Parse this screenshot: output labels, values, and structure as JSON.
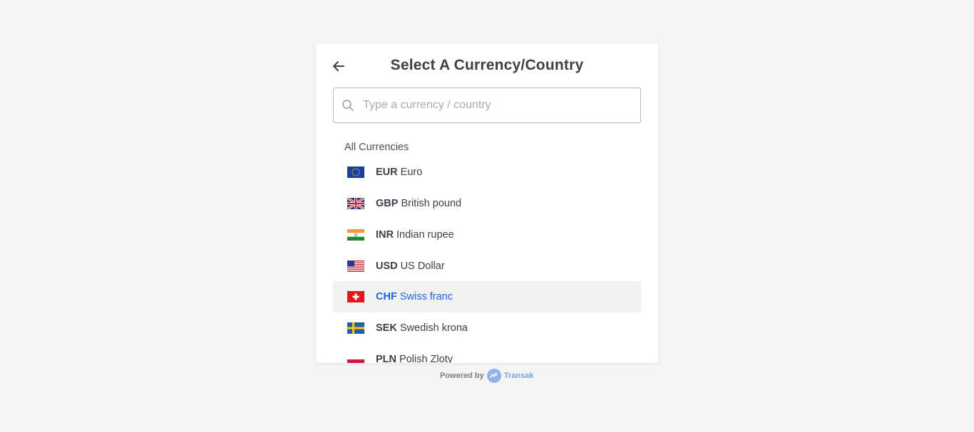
{
  "header": {
    "title": "Select A Currency/Country"
  },
  "search": {
    "placeholder": "Type a currency / country",
    "value": ""
  },
  "list": {
    "heading": "All Currencies",
    "items": [
      {
        "code": "EUR",
        "name": "Euro",
        "flag": "eu-flag-icon",
        "selected": false
      },
      {
        "code": "GBP",
        "name": "British pound",
        "flag": "uk-flag-icon",
        "selected": false
      },
      {
        "code": "INR",
        "name": "Indian rupee",
        "flag": "india-flag-icon",
        "selected": false
      },
      {
        "code": "USD",
        "name": "US Dollar",
        "flag": "usa-flag-icon",
        "selected": false
      },
      {
        "code": "CHF",
        "name": "Swiss franc",
        "flag": "switzerland-flag-icon",
        "selected": true
      },
      {
        "code": "SEK",
        "name": "Swedish krona",
        "flag": "sweden-flag-icon",
        "selected": false
      },
      {
        "code": "PLN",
        "name": "Polish Zloty",
        "flag": "poland-flag-icon",
        "selected": false
      }
    ]
  },
  "footer": {
    "powered_by": "Powered by",
    "brand": "Transak"
  },
  "colors": {
    "background": "#f5f5f5",
    "selected_text": "#1f62e0",
    "selected_bg": "#f2f2f3",
    "brand": "#7aa1e0"
  }
}
